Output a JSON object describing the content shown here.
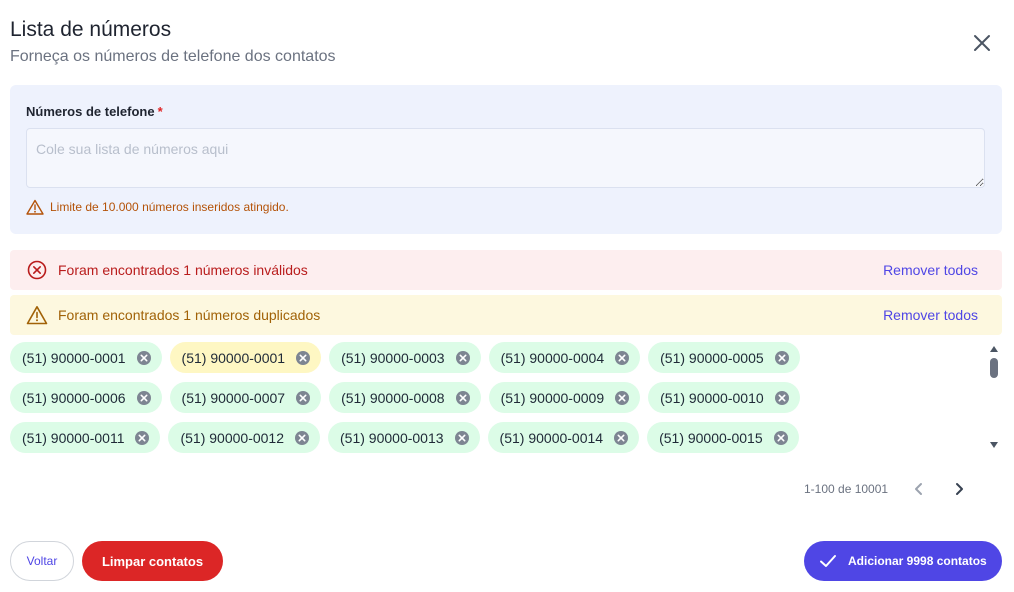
{
  "dialog": {
    "title": "Lista de números",
    "subtitle": "Forneça os números de telefone dos contatos"
  },
  "phone_field": {
    "label": "Números de telefone",
    "required_mark": "*",
    "placeholder": "Cole sua lista de números aqui",
    "value": "",
    "limit_warning": "Limite de 10.000 números inseridos atingido."
  },
  "alerts": {
    "invalid": {
      "text": "Foram encontrados 1 números inválidos",
      "action": "Remover todos"
    },
    "duplicate": {
      "text": "Foram encontrados 1 números duplicados",
      "action": "Remover todos"
    }
  },
  "chip_rows": [
    [
      {
        "label": "(51) 90000-0001",
        "status": "valid"
      },
      {
        "label": "(51) 90000-0001",
        "status": "duplicate"
      },
      {
        "label": "(51) 90000-0003",
        "status": "valid"
      },
      {
        "label": "(51) 90000-0004",
        "status": "valid"
      },
      {
        "label": "(51) 90000-0005",
        "status": "valid"
      }
    ],
    [
      {
        "label": "(51) 90000-0006",
        "status": "valid"
      },
      {
        "label": "(51) 90000-0007",
        "status": "valid"
      },
      {
        "label": "(51) 90000-0008",
        "status": "valid"
      },
      {
        "label": "(51) 90000-0009",
        "status": "valid"
      },
      {
        "label": "(51) 90000-0010",
        "status": "valid"
      }
    ],
    [
      {
        "label": "(51) 90000-0011",
        "status": "valid"
      },
      {
        "label": "(51) 90000-0012",
        "status": "valid"
      },
      {
        "label": "(51) 90000-0013",
        "status": "valid"
      },
      {
        "label": "(51) 90000-0014",
        "status": "valid"
      },
      {
        "label": "(51) 90000-0015",
        "status": "valid"
      }
    ]
  ],
  "pagination": {
    "range_text": "1-100 de 10001"
  },
  "footer": {
    "back_label": "Voltar",
    "clear_label": "Limpar contatos",
    "add_label": "Adicionar 9998 contatos"
  },
  "colors": {
    "accent": "#4f46e5",
    "danger": "#dc2626",
    "chip_valid": "#dcfce7",
    "chip_duplicate": "#fef7c3"
  },
  "icons": [
    "close-icon",
    "warning-triangle-icon",
    "error-circle-icon",
    "chip-remove-icon",
    "chevron-left-icon",
    "chevron-right-icon",
    "check-icon"
  ]
}
